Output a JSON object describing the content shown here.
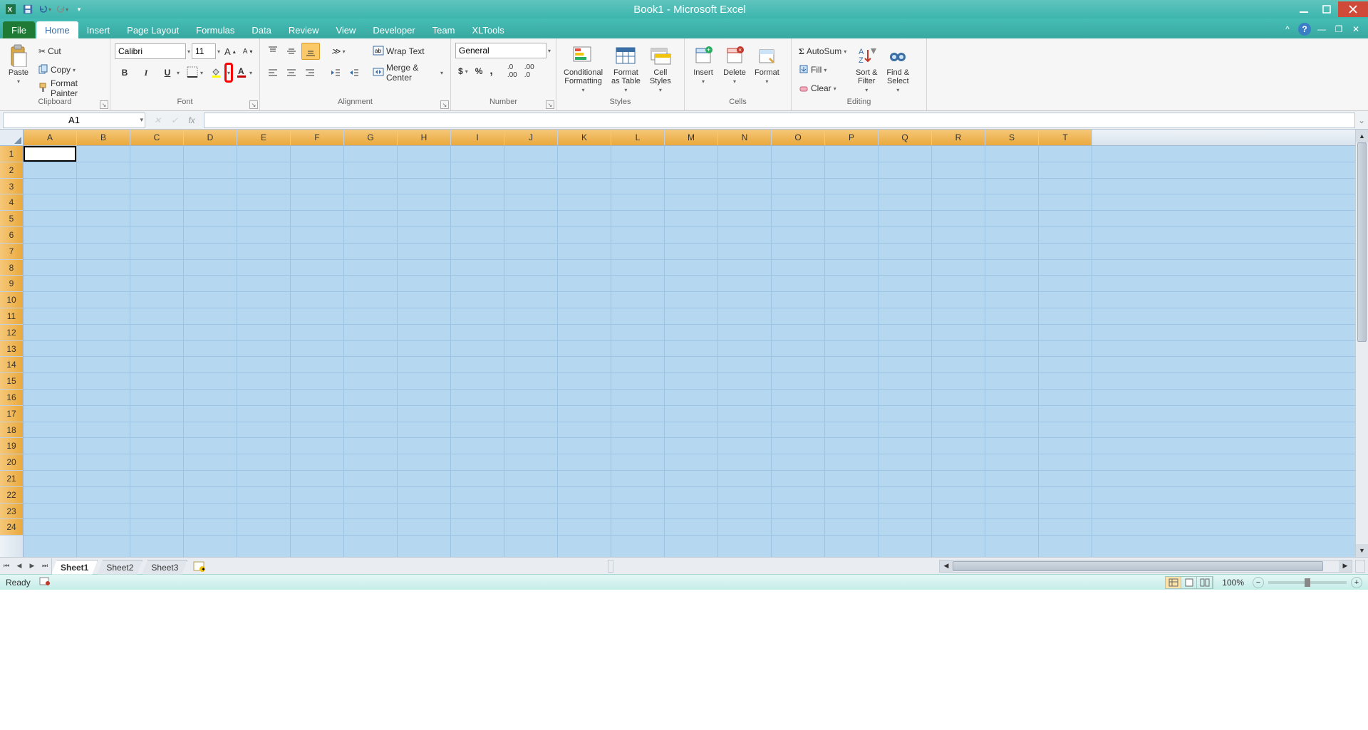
{
  "title": "Book1 - Microsoft Excel",
  "qat": {
    "save": "💾",
    "undo": "↶",
    "redo": "↷"
  },
  "tabs": {
    "file": "File",
    "list": [
      "Home",
      "Insert",
      "Page Layout",
      "Formulas",
      "Data",
      "Review",
      "View",
      "Developer",
      "Team",
      "XLTools"
    ],
    "active": "Home"
  },
  "ribbon": {
    "clipboard": {
      "label": "Clipboard",
      "paste": "Paste",
      "cut": "Cut",
      "copy": "Copy",
      "format_painter": "Format Painter"
    },
    "font": {
      "label": "Font",
      "name_value": "Calibri",
      "size_value": "11",
      "bold": "B",
      "italic": "I",
      "underline": "U"
    },
    "alignment": {
      "label": "Alignment",
      "wrap": "Wrap Text",
      "merge": "Merge & Center"
    },
    "number": {
      "label": "Number",
      "format_value": "General"
    },
    "styles": {
      "label": "Styles",
      "conditional": "Conditional\nFormatting",
      "as_table": "Format\nas Table",
      "cell_styles": "Cell\nStyles"
    },
    "cells": {
      "label": "Cells",
      "insert": "Insert",
      "delete": "Delete",
      "format": "Format"
    },
    "editing": {
      "label": "Editing",
      "autosum": "AutoSum",
      "fill": "Fill",
      "clear": "Clear",
      "sort": "Sort &\nFilter",
      "find": "Find &\nSelect"
    }
  },
  "formula_bar": {
    "name_box": "A1",
    "fx": "fx",
    "formula_value": ""
  },
  "grid": {
    "columns": [
      "A",
      "B",
      "C",
      "D",
      "E",
      "F",
      "G",
      "H",
      "I",
      "J",
      "K",
      "L",
      "M",
      "N",
      "O",
      "P",
      "Q",
      "R",
      "S",
      "T"
    ],
    "rows_visible": 24,
    "active_cell": "A1",
    "selection_fill": "#b5d7f0"
  },
  "sheet_tabs": {
    "tabs": [
      "Sheet1",
      "Sheet2",
      "Sheet3"
    ],
    "active": "Sheet1"
  },
  "status": {
    "mode": "Ready",
    "zoom": "100%"
  },
  "colors": {
    "accent": "#3cb6ae",
    "fill_highlight": "#ffc000",
    "font_color": "#c00000"
  }
}
